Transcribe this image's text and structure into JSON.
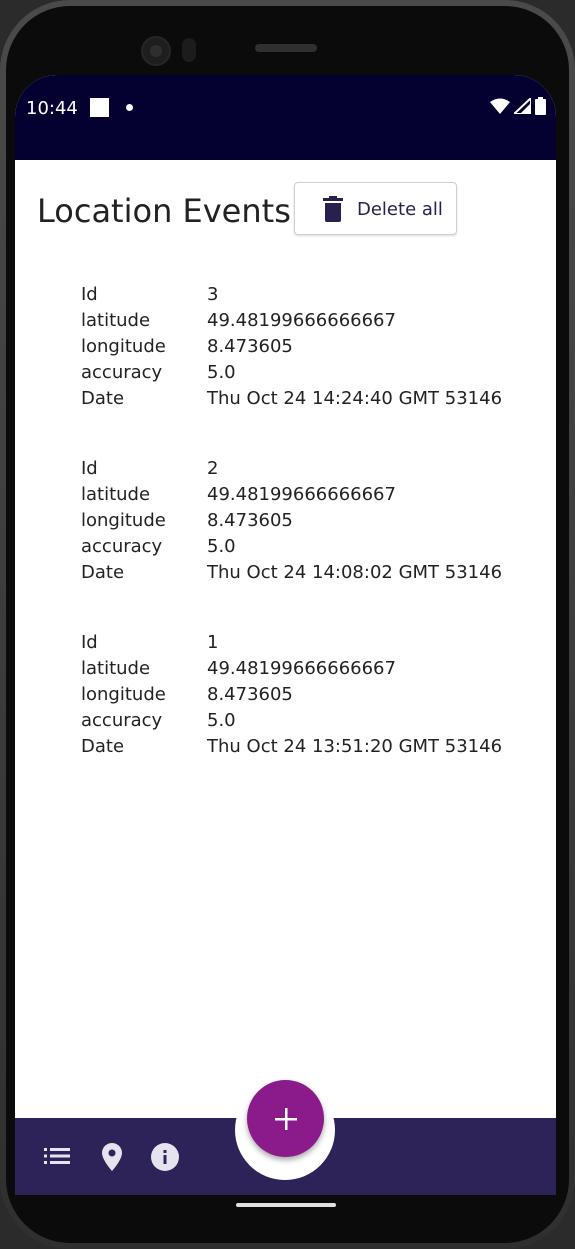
{
  "status_bar": {
    "time": "10:44"
  },
  "header": {
    "title": "Location Events",
    "delete_all_label": "Delete all",
    "delete_icon": "trash-icon"
  },
  "events": [
    {
      "rows": [
        {
          "key": "Id",
          "value": "3"
        },
        {
          "key": "latitude",
          "value": "49.48199666666667"
        },
        {
          "key": "longitude",
          "value": "8.473605"
        },
        {
          "key": "accuracy",
          "value": "5.0"
        },
        {
          "key": "Date",
          "value": "Thu Oct 24 14:24:40 GMT 53146"
        }
      ]
    },
    {
      "rows": [
        {
          "key": "Id",
          "value": "2"
        },
        {
          "key": "latitude",
          "value": "49.48199666666667"
        },
        {
          "key": "longitude",
          "value": "8.473605"
        },
        {
          "key": "accuracy",
          "value": "5.0"
        },
        {
          "key": "Date",
          "value": "Thu Oct 24 14:08:02 GMT 53146"
        }
      ]
    },
    {
      "rows": [
        {
          "key": "Id",
          "value": "1"
        },
        {
          "key": "latitude",
          "value": "49.48199666666667"
        },
        {
          "key": "longitude",
          "value": "8.473605"
        },
        {
          "key": "accuracy",
          "value": "5.0"
        },
        {
          "key": "Date",
          "value": "Thu Oct 24 13:51:20 GMT 53146"
        }
      ]
    }
  ],
  "bottom_nav": {
    "icons": [
      "list-icon",
      "location-pin-icon",
      "info-icon"
    ],
    "fab_icon": "plus-icon"
  },
  "colors": {
    "status_bar": "#040030",
    "bottom_bar": "#2e2359",
    "fab": "#8b1a8a",
    "accent_text": "#2a2050"
  }
}
